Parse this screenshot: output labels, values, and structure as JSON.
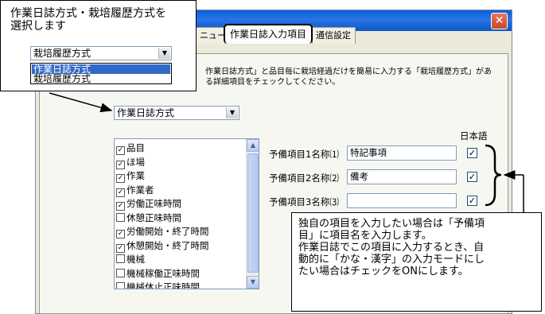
{
  "tabs": [
    "ニュー",
    "作業日誌入力項目",
    "通信設定"
  ],
  "description": {
    "line1": "作業日誌方式」と品目毎に栽培経過だけを簡易に入力する「栽培履歴方式」があ",
    "line2": "る詳細項目をチェックしてください。"
  },
  "method_select": {
    "value": "作業日誌方式"
  },
  "callout_top": {
    "line1": "作業日誌方式・栽培履歴方式を",
    "line2": "選択します",
    "select_value": "栽培履歴方式",
    "options": [
      "作業日誌方式",
      "栽培履歴方式"
    ]
  },
  "items": [
    {
      "label": "品目",
      "checked": true
    },
    {
      "label": "ほ場",
      "checked": true
    },
    {
      "label": "作業",
      "checked": true
    },
    {
      "label": "作業者",
      "checked": true
    },
    {
      "label": "労働正味時間",
      "checked": true
    },
    {
      "label": "休憩正味時間",
      "checked": false
    },
    {
      "label": "労働開始・終了時間",
      "checked": true
    },
    {
      "label": "休憩開始・終了時間",
      "checked": true
    },
    {
      "label": "機械",
      "checked": false
    },
    {
      "label": "機械稼働正味時間",
      "checked": false
    },
    {
      "label": "機械休止正味時間",
      "checked": false
    }
  ],
  "japanese_header": "日本語",
  "spare_items": [
    {
      "label": "予備項目1名称⑴",
      "value": "特記事項",
      "japanese": true
    },
    {
      "label": "予備項目2名称⑵",
      "value": "備考",
      "japanese": true
    },
    {
      "label": "予備項目3名称⑶",
      "value": "",
      "japanese": true
    }
  ],
  "callout_bottom": {
    "line1": "独自の項目を入力したい場合は「予備項",
    "line2": "目」に項目名を入力します。",
    "line3": "作業日誌でこの項目に入力するとき、自",
    "line4": "動的に「かな・漢字」の入力モードにし",
    "line5": "たい場合はチェックをONにします。"
  }
}
